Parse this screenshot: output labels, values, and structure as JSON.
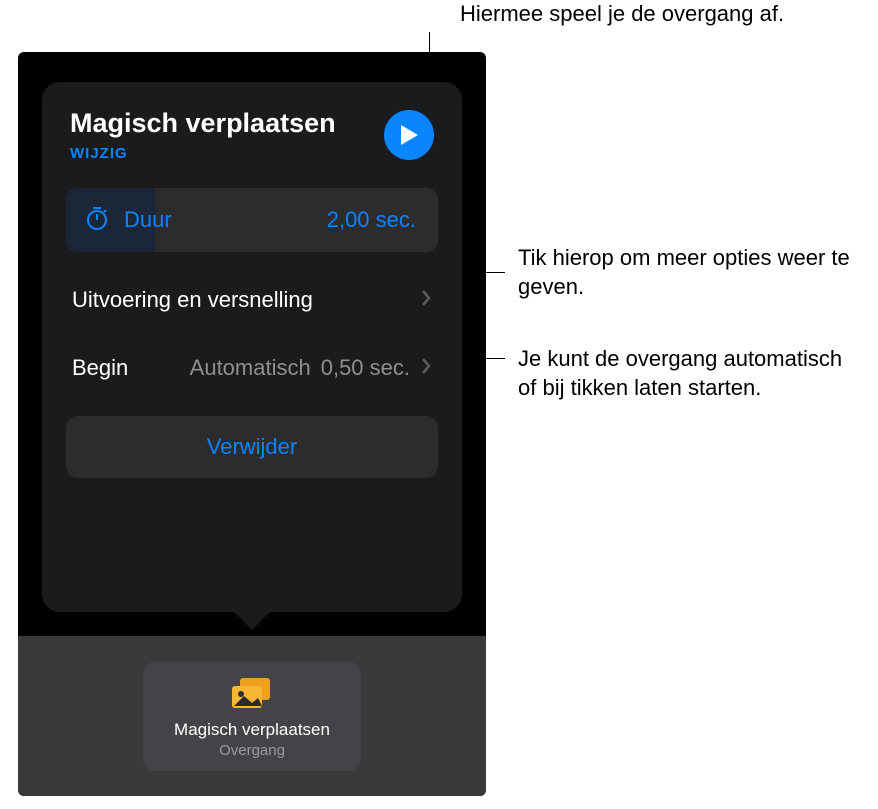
{
  "callouts": {
    "play": "Hiermee speel je de overgang af.",
    "options": "Tik hierop om meer opties weer te geven.",
    "start": "Je kunt de overgang automatisch of bij tikken laten starten."
  },
  "popover": {
    "title": "Magisch verplaatsen",
    "edit": "WIJZIG",
    "duration_label": "Duur",
    "duration_value": "2,00 sec.",
    "perf_row": "Uitvoering en versnelling",
    "begin_label": "Begin",
    "begin_mode": "Automatisch",
    "begin_delay": "0,50 sec.",
    "delete": "Verwijder"
  },
  "thumb": {
    "title": "Magisch verplaatsen",
    "sub": "Overgang"
  }
}
